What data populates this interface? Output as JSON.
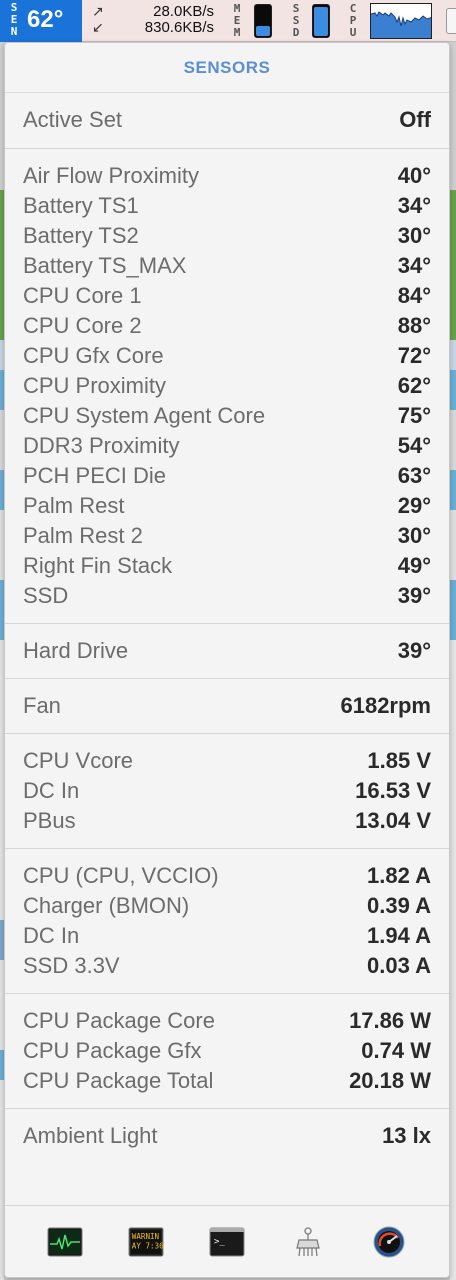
{
  "menubar": {
    "sen_letters": "SEN",
    "temperature": "62°",
    "net_up_arrow": "↗",
    "net_down_arrow": "↙",
    "net_up": "28.0KB/s",
    "net_down": "830.6KB/s",
    "mem_letters": "MEM",
    "ssd_letters": "SSD",
    "cpu_letters": "CPU",
    "mem_level": 0.3,
    "ssd_level": 0.92,
    "accent": "#1a73d9"
  },
  "panel": {
    "title": "SENSORS",
    "active_set": {
      "label": "Active Set",
      "value": "Off"
    },
    "temperatures": [
      {
        "label": "Air Flow Proximity",
        "value": "40°"
      },
      {
        "label": "Battery TS1",
        "value": "34°"
      },
      {
        "label": "Battery TS2",
        "value": "30°"
      },
      {
        "label": "Battery TS_MAX",
        "value": "34°"
      },
      {
        "label": "CPU Core 1",
        "value": "84°"
      },
      {
        "label": "CPU Core 2",
        "value": "88°"
      },
      {
        "label": "CPU Gfx Core",
        "value": "72°"
      },
      {
        "label": "CPU Proximity",
        "value": "62°"
      },
      {
        "label": "CPU System Agent Core",
        "value": "75°"
      },
      {
        "label": "DDR3 Proximity",
        "value": "54°"
      },
      {
        "label": "PCH PECI Die",
        "value": "63°"
      },
      {
        "label": "Palm Rest",
        "value": "29°"
      },
      {
        "label": "Palm Rest 2",
        "value": "30°"
      },
      {
        "label": "Right Fin Stack",
        "value": "49°"
      },
      {
        "label": "SSD",
        "value": "39°"
      }
    ],
    "hard_drive": {
      "label": "Hard Drive",
      "value": "39°"
    },
    "fan": {
      "label": "Fan",
      "value": "6182rpm"
    },
    "voltages": [
      {
        "label": "CPU Vcore",
        "value": "1.85 V"
      },
      {
        "label": "DC In",
        "value": "16.53 V"
      },
      {
        "label": "PBus",
        "value": "13.04 V"
      }
    ],
    "currents": [
      {
        "label": "CPU (CPU, VCCIO)",
        "value": "1.82 A"
      },
      {
        "label": "Charger (BMON)",
        "value": "0.39 A"
      },
      {
        "label": "DC In",
        "value": "1.94 A"
      },
      {
        "label": "SSD 3.3V",
        "value": "0.03 A"
      }
    ],
    "power": [
      {
        "label": "CPU Package Core",
        "value": "17.86 W"
      },
      {
        "label": "CPU Package Gfx",
        "value": "0.74 W"
      },
      {
        "label": "CPU Package Total",
        "value": "20.18 W"
      }
    ],
    "ambient": {
      "label": "Ambient Light",
      "value": "13 lx"
    }
  },
  "toolbar": {
    "activity_icon": "activity-monitor-icon",
    "console_icon": "console-icon",
    "console_text_1": "WARNIN",
    "console_text_2": "AY 7:36",
    "terminal_icon": "terminal-icon",
    "terminal_prompt": ">_",
    "utility_icon": "utility-icon",
    "speed_icon": "speedometer-icon"
  }
}
